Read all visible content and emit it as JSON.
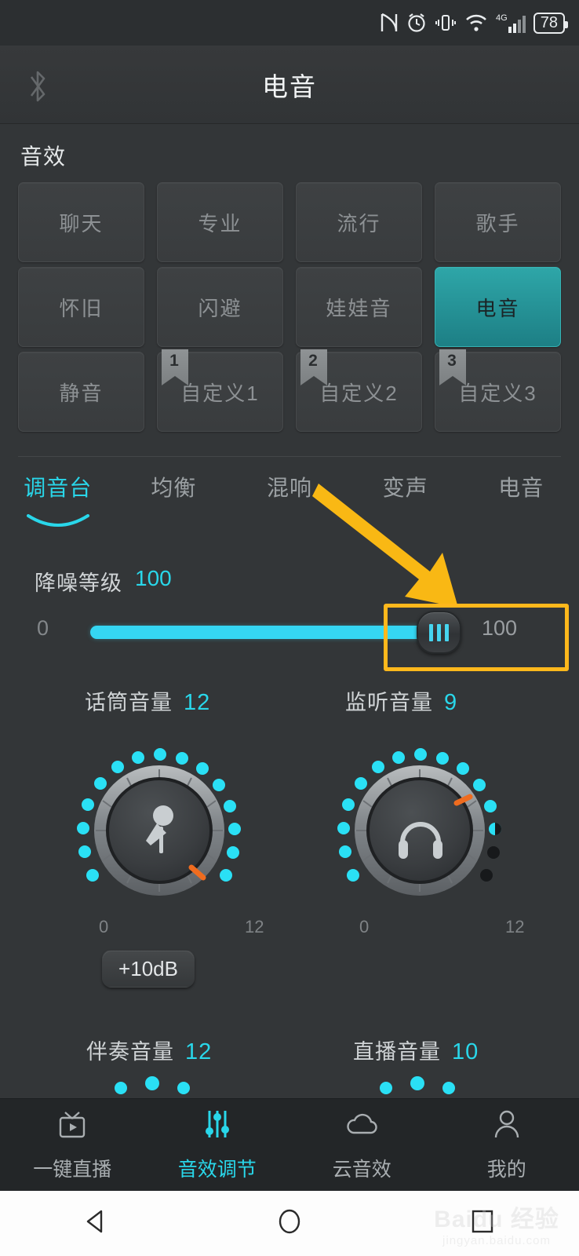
{
  "status_bar": {
    "icons": [
      "nfc-icon",
      "alarm-icon",
      "vibrate-icon",
      "wifi-icon",
      "signal-4g-icon"
    ],
    "network_label": "4G",
    "battery_level": "78"
  },
  "header": {
    "title": "电音",
    "left_icon": "bluetooth-icon"
  },
  "effects": {
    "section_label": "音效",
    "presets": [
      {
        "label": "聊天",
        "selected": false,
        "badge": ""
      },
      {
        "label": "专业",
        "selected": false,
        "badge": ""
      },
      {
        "label": "流行",
        "selected": false,
        "badge": ""
      },
      {
        "label": "歌手",
        "selected": false,
        "badge": ""
      },
      {
        "label": "怀旧",
        "selected": false,
        "badge": ""
      },
      {
        "label": "闪避",
        "selected": false,
        "badge": ""
      },
      {
        "label": "娃娃音",
        "selected": false,
        "badge": ""
      },
      {
        "label": "电音",
        "selected": true,
        "badge": ""
      },
      {
        "label": "静音",
        "selected": false,
        "badge": ""
      },
      {
        "label": "自定义1",
        "selected": false,
        "badge": "1"
      },
      {
        "label": "自定义2",
        "selected": false,
        "badge": "2"
      },
      {
        "label": "自定义3",
        "selected": false,
        "badge": "3"
      }
    ]
  },
  "tabs": [
    {
      "label": "调音台",
      "active": true
    },
    {
      "label": "均衡",
      "active": false
    },
    {
      "label": "混响",
      "active": false
    },
    {
      "label": "变声",
      "active": false
    },
    {
      "label": "电音",
      "active": false
    }
  ],
  "noise_reduction": {
    "label": "降噪等级",
    "value": "100",
    "min_label": "0",
    "max_label": "100",
    "fill_percent": 100
  },
  "knobs": [
    {
      "label": "话筒音量",
      "value": "12",
      "icon": "microphone-icon",
      "scale_min": "0",
      "scale_max": "12",
      "lit_dots": 17,
      "total_dots": 17
    },
    {
      "label": "监听音量",
      "value": "9",
      "icon": "headphones-icon",
      "scale_min": "0",
      "scale_max": "12",
      "lit_dots": 13,
      "total_dots": 17
    }
  ],
  "gain_button": {
    "label": "+10dB"
  },
  "knobs_row2": [
    {
      "label": "伴奏音量",
      "value": "12"
    },
    {
      "label": "直播音量",
      "value": "10"
    }
  ],
  "annotation": {
    "arrow_color": "#ffb81c",
    "highlight_color": "#ffb81c",
    "target": "noise-reduction-slider-thumb"
  },
  "bottom_nav": [
    {
      "label": "一键直播",
      "icon": "tv-play-icon",
      "active": false
    },
    {
      "label": "音效调节",
      "icon": "equalizer-icon",
      "active": true
    },
    {
      "label": "云音效",
      "icon": "cloud-icon",
      "active": false
    },
    {
      "label": "我的",
      "icon": "person-icon",
      "active": false
    }
  ],
  "system_nav": {
    "back": "back-triangle-icon",
    "home": "home-circle-icon",
    "recents": "recents-square-icon"
  },
  "watermark": {
    "line1": "Baidu 经验",
    "line2": "jingyan.baidu.com"
  },
  "colors": {
    "accent_cyan": "#29d7ea",
    "selected_teal": "#2ea6a8",
    "annotation_orange": "#ffb81c",
    "background": "#333638"
  }
}
